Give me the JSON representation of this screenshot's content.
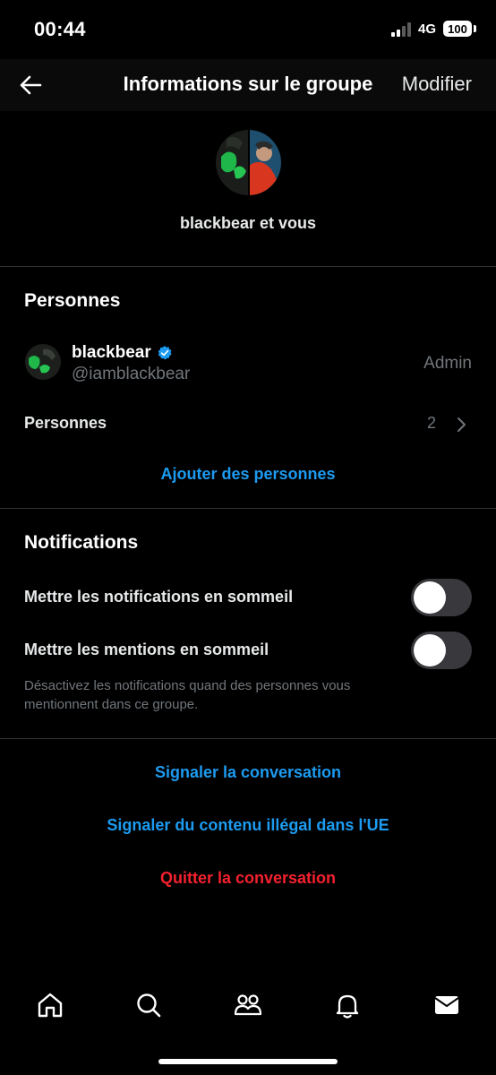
{
  "status_bar": {
    "time": "00:44",
    "network": "4G",
    "battery": "100"
  },
  "header": {
    "title": "Informations sur le groupe",
    "edit_label": "Modifier"
  },
  "group": {
    "name": "blackbear et vous"
  },
  "people_section": {
    "title": "Personnes",
    "member": {
      "name": "blackbear",
      "handle": "@iamblackbear",
      "role": "Admin",
      "verified": true
    },
    "people_row_label": "Personnes",
    "people_count": "2",
    "add_people_label": "Ajouter des personnes"
  },
  "notifications_section": {
    "title": "Notifications",
    "snooze_notifications_label": "Mettre les notifications en sommeil",
    "snooze_notifications_on": false,
    "snooze_mentions_label": "Mettre les mentions en sommeil",
    "snooze_mentions_on": false,
    "helper_text": "Désactivez les notifications quand des personnes vous mentionnent dans ce groupe."
  },
  "actions": {
    "report_conversation": "Signaler la conversation",
    "report_illegal_content": "Signaler du contenu illégal dans l'UE",
    "leave_conversation": "Quitter la conversation"
  },
  "bottom_nav": {
    "items": [
      "home-icon",
      "search-icon",
      "communities-icon",
      "notifications-bell-icon",
      "messages-envelope-icon"
    ]
  },
  "colors": {
    "accent": "#1d9bf0",
    "danger": "#f4212e",
    "muted": "#71767b",
    "background": "#000000"
  }
}
